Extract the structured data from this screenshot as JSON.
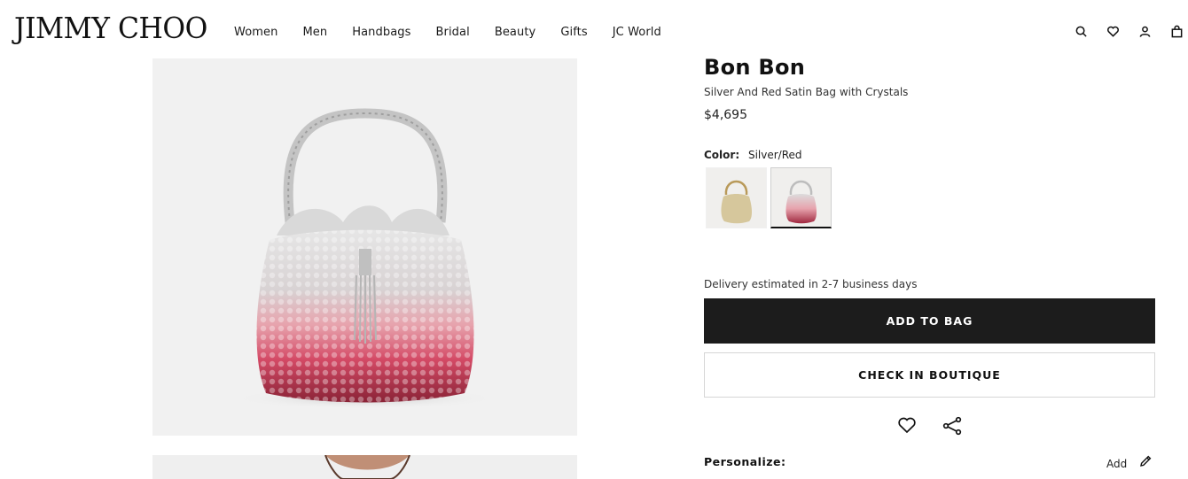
{
  "header": {
    "logo": "JIMMY CHOO",
    "nav": [
      "Women",
      "Men",
      "Handbags",
      "Bridal",
      "Beauty",
      "Gifts",
      "JC World"
    ],
    "icons": [
      "search-icon",
      "heart-icon",
      "account-icon",
      "bag-icon"
    ]
  },
  "product": {
    "title": "Bon Bon",
    "subtitle": "Silver And Red Satin Bag with Crystals",
    "price": "$4,695",
    "color_label": "Color:",
    "color_value": "Silver/Red",
    "swatches": [
      "gold-swatch",
      "silver-red-swatch"
    ],
    "selected_swatch": 1,
    "delivery": "Delivery estimated in 2-7 business days",
    "add_to_bag": "ADD TO BAG",
    "check_in_boutique": "CHECK IN BOUTIQUE",
    "personalize_label": "Personalize:",
    "personalize_action": "Add"
  },
  "colors": {
    "primary_button": "#1c1c1c",
    "text": "#1a1a1a",
    "gallery_bg": "#f1f1f1"
  }
}
